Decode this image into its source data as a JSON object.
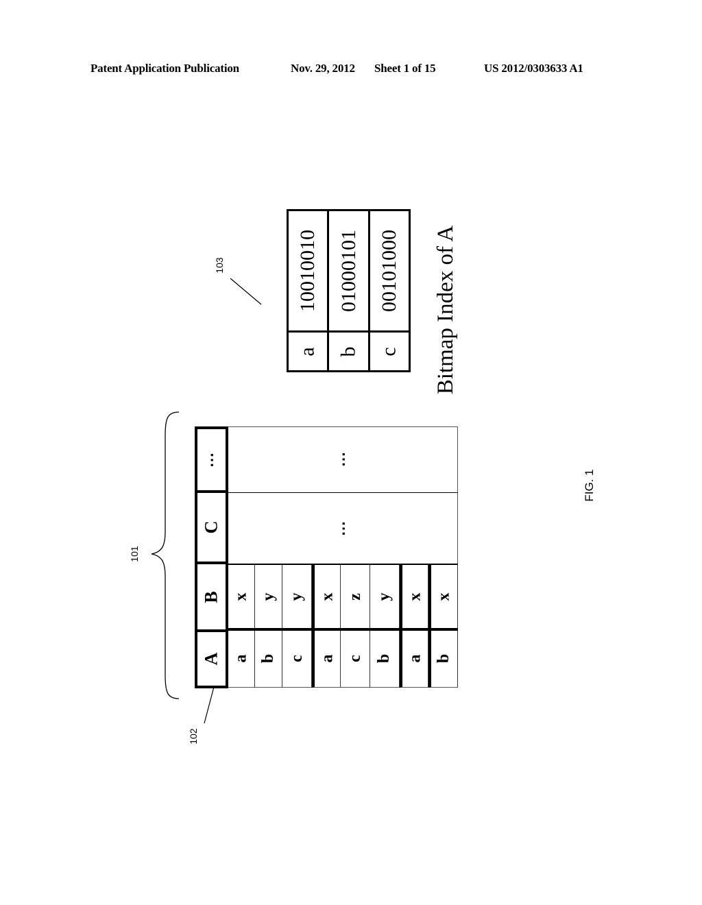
{
  "header": {
    "publication": "Patent Application Publication",
    "date": "Nov. 29, 2012",
    "sheet": "Sheet 1 of 15",
    "number": "US 2012/0303633 A1"
  },
  "figure": {
    "caption": "FIG. 1",
    "refs": {
      "table": "101",
      "column_a": "102",
      "bitmap_index": "103"
    },
    "main_table": {
      "columns": [
        {
          "name": "A",
          "values": [
            "a",
            "b",
            "c",
            "a",
            "c",
            "b",
            "a",
            "b"
          ]
        },
        {
          "name": "B",
          "values": [
            "x",
            "y",
            "y",
            "x",
            "z",
            "y",
            "x",
            "x"
          ]
        },
        {
          "name": "C",
          "values": [
            "..."
          ]
        },
        {
          "name": "...",
          "values": [
            "..."
          ]
        }
      ]
    },
    "bitmap_index": {
      "title": "Bitmap Index of A",
      "rows": [
        {
          "key": "a",
          "bits": "10010010"
        },
        {
          "key": "b",
          "bits": "01000101"
        },
        {
          "key": "c",
          "bits": "00101000"
        }
      ]
    }
  }
}
